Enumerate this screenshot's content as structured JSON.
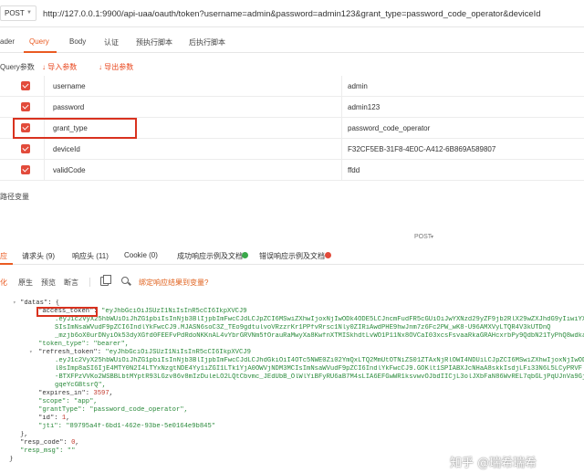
{
  "request": {
    "method": "POST",
    "url": "http://127.0.0.1:9900/api-uaa/oauth/token?username=admin&password=admin123&grant_type=password_code_operator&deviceId"
  },
  "request_tabs": [
    "ader",
    "Query",
    "Body",
    "认证",
    "预执行脚本",
    "后执行脚本"
  ],
  "active_request_tab": "Query",
  "query_toolbar": {
    "label": "Query参数",
    "import_label": "导入参数",
    "export_label": "导出参数"
  },
  "params": [
    {
      "key": "username",
      "value": "admin",
      "checked": true
    },
    {
      "key": "password",
      "value": "admin123",
      "checked": true
    },
    {
      "key": "grant_type",
      "value": "password_code_operator",
      "checked": true,
      "highlighted": true
    },
    {
      "key": "deviceId",
      "value": "F32CF5EB-31F8-4E0C-A412-6B869A589807",
      "checked": true
    },
    {
      "key": "validCode",
      "value": "ffdd",
      "checked": true
    }
  ],
  "path_vars_label": "路径变量",
  "post_indicator": "POST",
  "response_tabs": {
    "response": "应",
    "request_headers": "请求头 (9)",
    "response_headers": "响应头 (11)",
    "cookie": "Cookie (0)",
    "success_example": "成功响应示例及文档",
    "error_example": "错误响应示例及文档"
  },
  "format_toolbar": {
    "beautify": "化",
    "raw": "原生",
    "preview": "预览",
    "assert": "断言",
    "bind_link": "绑定响应结果到变量?"
  },
  "response_body": {
    "data_key": "\"datas\"",
    "access_token_key": "\"access_token\"",
    "access_token_lines": [
      "\"eyJhbGciOiJSUzI1NiIsInR5cCI6IkpXVCJ9",
      ".eyJ1c2VyX25hbWUiOiJhZG1pbiIsInNjb3BlIjpbImFwcCJdLCJpZCI6MSwiZXhwIjoxNjIwODk4ODE5LCJncmFudFR5cGUiOiJwYXNzd29yZF9jb2RlX29wZXJhdG9yIiwiYXV0aG9yaXRpZXMiOlsiQURNSU4iXX0",
      "SIsImNsaWVudF9pZCI6IndlYkFwcCJ9.MJASN6soC3Z_TEo9gdtulvoVRzzrKr1PPfvRrsc1Nly0ZIRiAwdPHE9hwJnm7z6Fc2PW_wK8-U96AMXVyLTQR4V3kUTDnQ",
      "_mzjb6oX0urDNyiOk53dyXGfd0FEEFvPdRdoNKKnAL4vYbrGRVNm5fOrauRaMwyXa8KwfnXTMISkhdtLvWO1P11Nx8OVCaI03xcsFsvaaRkaGRAHcxrbPy9QdbN21TyPhQ8wdka"
    ],
    "token_type_line": "\"token_type\": \"bearer\",",
    "refresh_token_key": "\"refresh_token\":",
    "refresh_token_lines": [
      "\"eyJhbGciOiJSUzI1NiIsInR5cCI6IkpXVCJ9",
      ".eyJ1c2VyX25hbWUiOiJhZG1pbiIsInNjb3BlIjpbImFwcCJdLCJhdGkiOiI4OTc5NWE0Zi02YmQxLTQ2MmUtOTNiZS01ZTAxNjRlOWI4NDUiLCJpZCI6MSwiZXhwIjoxNjIwODk4",
      "l0sImp8aSI6IjE4MTY0N2I4LTYxNzgtNDE4Yy1iZGI1LTk1YjA0OWVjNDM3MCIsImNsaWVudF9pZCI6IndlYkFwcCJ9.GOKlt1SPIABXJcNHaA8skkIsdjLFi33N6L5LCyPRVF",
      "-BTXFPzVVKo2WSBBLbtMYptR93LGzv86v8mIzDuleLO2LQtCbvmc_JEdUbB_OlWlYiBFyRU6aB7M4sLIA6EFGwWR1ksvwvOJbdIICjL3olJXbFaN86WvREL7qbGLjPqUJnVa9GjGp",
      "gqeYcGBtsrQ\","
    ],
    "expires_in_key": "\"expires_in\":",
    "expires_in_value": "3597",
    "scope_line": "\"scope\": \"app\",",
    "grant_type_line": "\"grantType\": \"password_code_operator\",",
    "id_key": "\"id\":",
    "id_value": "1",
    "jti_line": "\"jti\": \"89795a4f-6bd1-462e-93be-5e0164e9b845\"",
    "close_inner": "},",
    "resp_code_key": "\"resp_code\":",
    "resp_code_value": "0",
    "resp_msg_line": "\"resp_msg\": \"\"",
    "close_outer": "}"
  },
  "watermark": "知乎 @瑞希瑞希",
  "colors": {
    "accent": "#ea5b22",
    "checkbox": "#e24b3b",
    "highlight_border": "#d9321f",
    "string": "#2a8a3b",
    "number": "#c2382c"
  }
}
